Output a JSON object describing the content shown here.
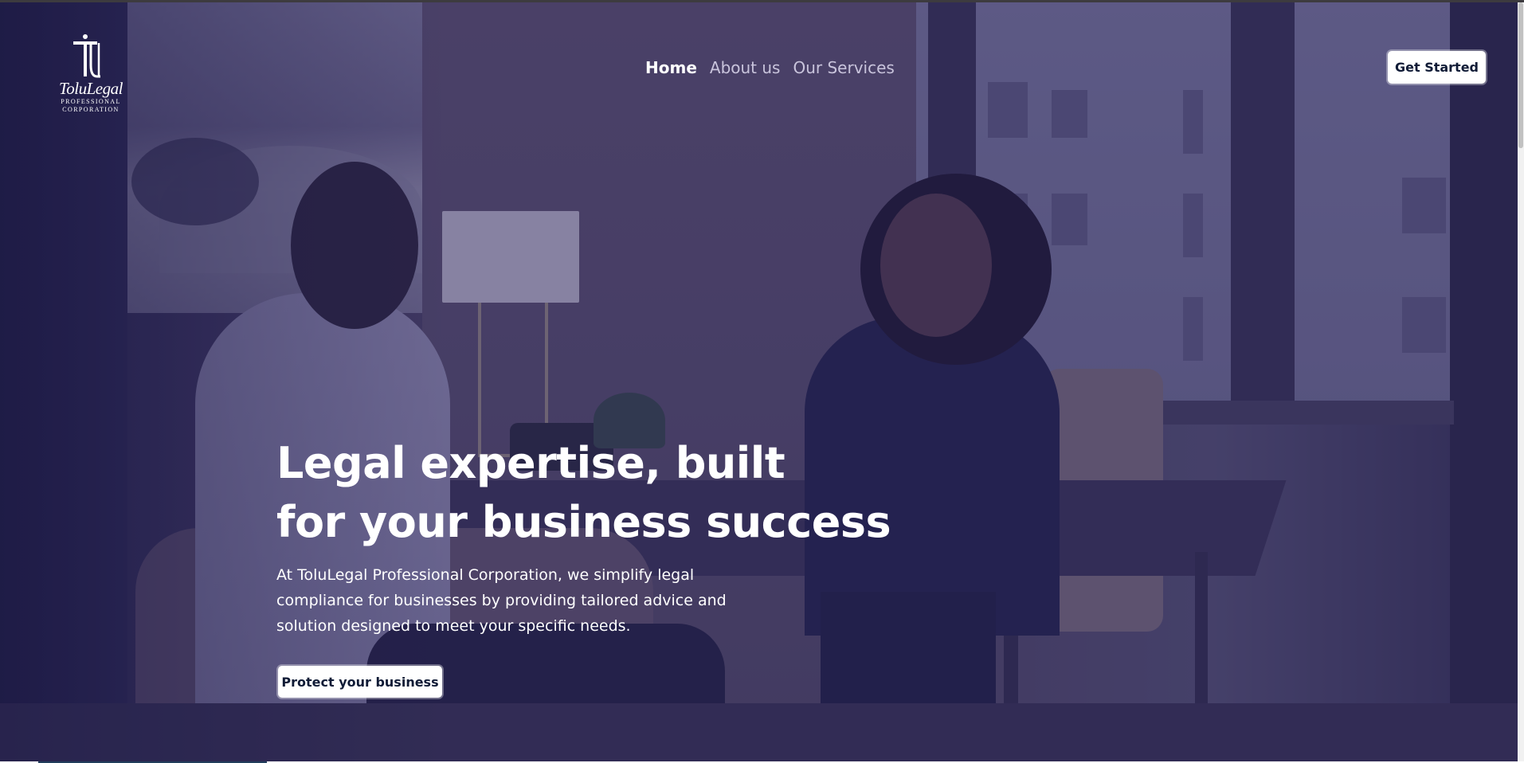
{
  "brand": {
    "logo_word": "ToluLegal",
    "logo_sub_1": "PROFESSIONAL",
    "logo_sub_2": "CORPORATION"
  },
  "nav": {
    "items": [
      {
        "label": "Home",
        "active": true
      },
      {
        "label": "About us",
        "active": false
      },
      {
        "label": "Our Services",
        "active": false
      }
    ]
  },
  "header": {
    "cta_label": "Get Started"
  },
  "hero": {
    "title_lines": [
      "Legal expertise, built",
      "for your business success"
    ],
    "description_lines": [
      "At ToluLegal Professional Corporation, we simplify legal",
      "compliance for businesses by providing tailored advice and",
      "solution designed to meet your specific needs."
    ],
    "cta_label": "Protect your business"
  },
  "colors": {
    "overlay": "#26225c",
    "button_text": "#101b36",
    "nav_inactive": "#c9c4dc",
    "text": "#ffffff"
  },
  "icons": {
    "logo": "tolulegal-logo-icon"
  }
}
